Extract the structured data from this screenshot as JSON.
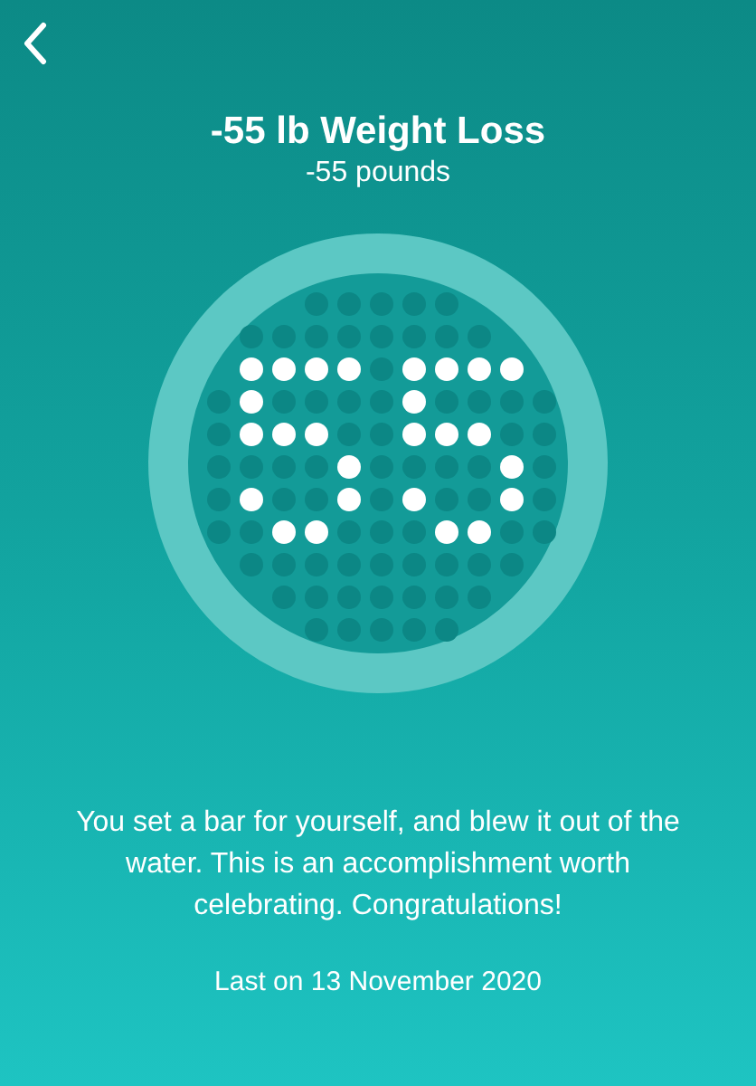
{
  "title": "-55 lb Weight Loss",
  "subtitle": "-55 pounds",
  "message": "You set a bar for yourself, and blew it out of the water. This is an accomplishment worth celebrating. Congratulations!",
  "last_earned": "Last on 13 November 2020"
}
